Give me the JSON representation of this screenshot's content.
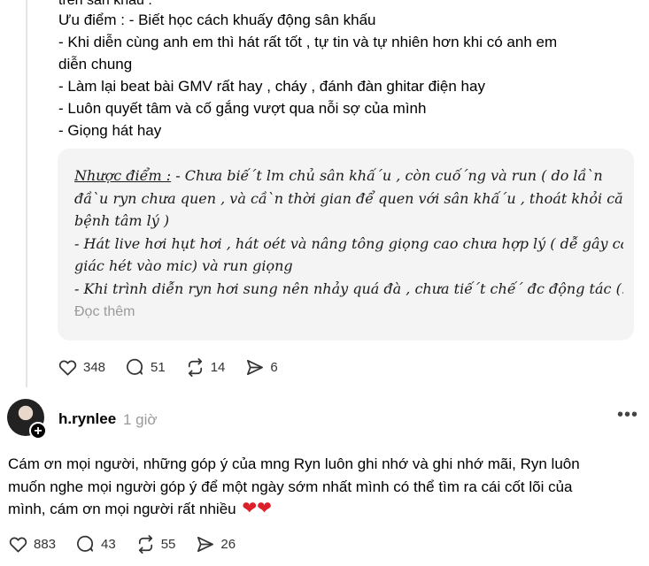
{
  "post": {
    "clipped_line": "trên sân khấu .",
    "lines": [
      "Ưu điểm : - Biết học cách khuấy động sân khấu",
      "- Khi diễn cùng anh em thì hát rất tốt , tự tin và tự nhiên hơn khi có anh em",
      "diễn chung",
      "- Làm lại beat bài GMV rất hay , cháy , đánh đàn ghitar điện hay",
      "- Luôn quyết tâm và cố gắng vượt qua nỗi sợ của mình",
      "- Giọng hát hay"
    ]
  },
  "quote": {
    "heading": "Nhược điểm :",
    "first_line_rest": " - Chưa biế´t lm chủ sân khấ´u , còn cuố´ng và run ( do lầ`n",
    "lines": [
      "đầ`u ryn chưa quen , và cầ`n thời gian để quen với sân khấ´u , thoát khỏi căn",
      "bệnh tâm lý )",
      "- Hát live hơi hụt hơi , hát oét và nâng tông giọng cao chưa hợp lý ( dễ gây cảm",
      "giác hét vào mic) và run giọng",
      "- Khi trình diễn ryn hơi sung nên nhảy quá đà , chưa tiế´t chế´ đc động tác (..."
    ],
    "read_more": "Đọc thêm"
  },
  "post_actions": {
    "likes": "348",
    "comments": "51",
    "reposts": "14",
    "shares": "6"
  },
  "reply": {
    "username": "h.rynlee",
    "time": "1 giờ",
    "lines": [
      "Cám ơn mọi người, những góp ý của mng Ryn luôn ghi nhớ và ghi nhớ mãi, Ryn luôn",
      "muốn nghe mọi người góp ý để một ngày sớm nhất mình có thể tìm ra cái cốt lõi của",
      "mình, cám ơn mọi người rất nhiều"
    ],
    "hearts": "❤❤",
    "actions": {
      "likes": "883",
      "comments": "43",
      "reposts": "55",
      "shares": "26"
    }
  }
}
